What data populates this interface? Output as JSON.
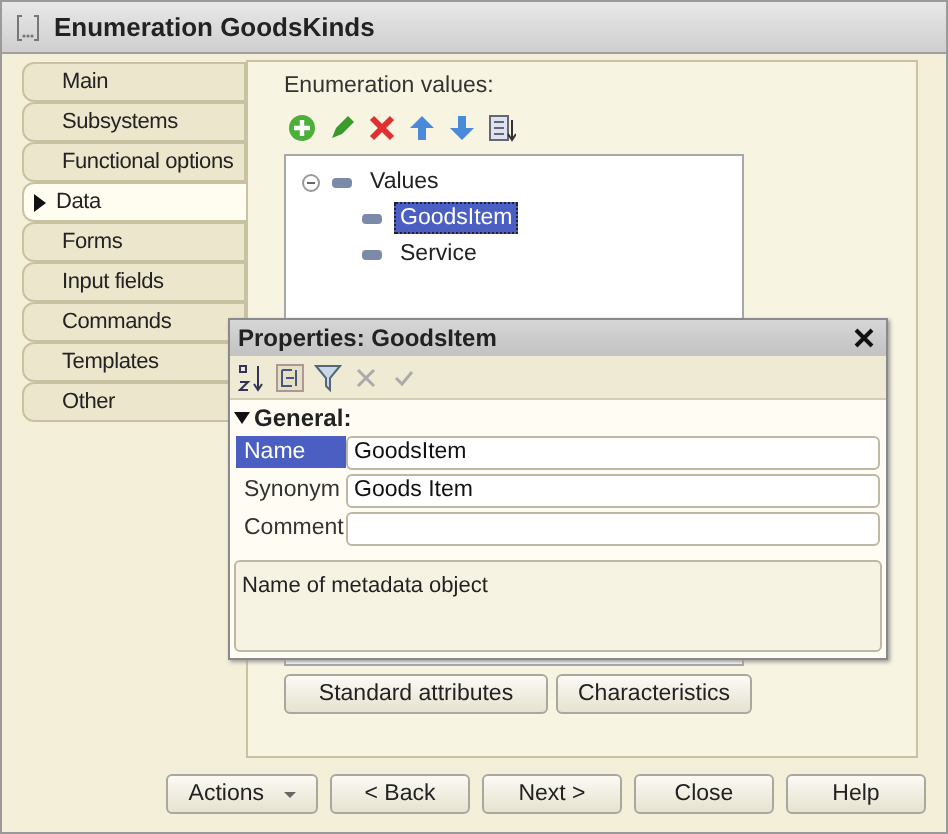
{
  "window": {
    "title": "Enumeration GoodsKinds"
  },
  "tabs": [
    {
      "label": "Main",
      "selected": false
    },
    {
      "label": "Subsystems",
      "selected": false
    },
    {
      "label": "Functional options",
      "selected": false
    },
    {
      "label": "Data",
      "selected": true
    },
    {
      "label": "Forms",
      "selected": false
    },
    {
      "label": "Input fields",
      "selected": false
    },
    {
      "label": "Commands",
      "selected": false
    },
    {
      "label": "Templates",
      "selected": false
    },
    {
      "label": "Other",
      "selected": false
    }
  ],
  "values_label": "Enumeration values:",
  "tree": {
    "label": "Values",
    "expanded": true,
    "children": [
      {
        "label": "GoodsItem",
        "selected": true
      },
      {
        "label": "Service",
        "selected": false
      }
    ]
  },
  "tree_buttons": [
    "Standard attributes",
    "Characteristics"
  ],
  "properties": {
    "title": "Properties: GoodsItem",
    "group": "General:",
    "group_expanded": true,
    "fields": [
      {
        "label": "Name",
        "value": "GoodsItem",
        "selected": true
      },
      {
        "label": "Synonym",
        "value": "Goods Item",
        "selected": false
      },
      {
        "label": "Comment",
        "selected": false
      }
    ],
    "description": "Name of metadata object"
  },
  "buttons": [
    {
      "label": "Actions",
      "kind": "dropdown"
    },
    {
      "label": "< Back",
      "kind": "plain"
    },
    {
      "label": "Next >",
      "kind": "plain"
    },
    {
      "label": "Close",
      "kind": "plain"
    },
    {
      "label": "Help",
      "kind": "plain"
    }
  ]
}
